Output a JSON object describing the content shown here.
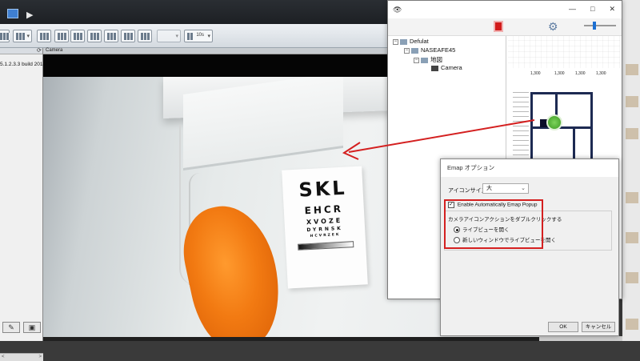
{
  "window": {
    "minimize": "—",
    "maximize": "□",
    "close": "✕"
  },
  "toolbar": {
    "interval_label": "10s"
  },
  "sidebar": {
    "build_text": "5.1.2.3.3 build 2018",
    "scroll_left": "<",
    "scroll_right": ">"
  },
  "camera_panel": {
    "header_label": "Camera",
    "eye_chart": {
      "line1": "SKL",
      "line2": "EHCR",
      "line3": "XVOZE",
      "line4": "DYRNSK",
      "line5": "HCVRZEK"
    }
  },
  "emap": {
    "window_controls": [
      "—",
      "□",
      "✕"
    ],
    "tree": {
      "root": "Defulat",
      "server": "NASEAFE45",
      "map": "地図",
      "camera": "Camera"
    },
    "floorplan_dims": [
      "1,300",
      "1,300",
      "1,300",
      "1,300"
    ]
  },
  "options_dialog": {
    "title": "Emap オプション",
    "icon_size_label": "アイコンサイズ：",
    "icon_size_value": "大",
    "enable_popup_label": "Enable Automatically Emap Popup",
    "double_click_label": "カメラアイコンアクションをダブルクリックする",
    "radio_live_view": "ライブビューを開く",
    "radio_new_window": "新しいウィンドウでライブビューを開く",
    "ok": "OK",
    "cancel": "キャンセル"
  },
  "colors": {
    "highlight_red": "#d42020",
    "camera_green": "#3c9a22",
    "emap_icon_red": "#d21b1b"
  }
}
